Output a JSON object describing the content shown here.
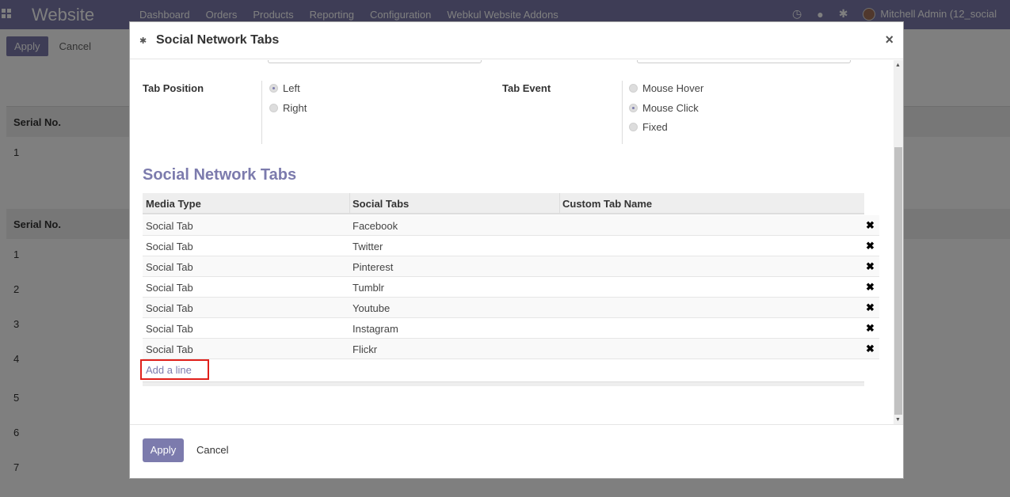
{
  "navbar": {
    "brand": "Website",
    "menu": [
      "Dashboard",
      "Orders",
      "Products",
      "Reporting",
      "Configuration",
      "Webkul Website Addons"
    ],
    "icons": [
      "clock-icon",
      "chat-icon",
      "bug-icon"
    ],
    "user": "Mitchell Admin (12_social"
  },
  "background": {
    "apply_label": "Apply",
    "cancel_label": "Cancel",
    "serial_header_1": "Serial No.",
    "serial_header_2": "Serial No.",
    "serial_values_1": [
      "1"
    ],
    "serial_values_2": [
      "1",
      "2",
      "3",
      "4",
      "5",
      "6",
      "7"
    ]
  },
  "modal": {
    "title": "Social Network Tabs",
    "close": "×",
    "tab_position": {
      "label": "Tab Position",
      "options": [
        {
          "label": "Left",
          "checked": true
        },
        {
          "label": "Right",
          "checked": false
        }
      ]
    },
    "tab_event": {
      "label": "Tab Event",
      "options": [
        {
          "label": "Mouse Hover",
          "checked": false
        },
        {
          "label": "Mouse Click",
          "checked": true
        },
        {
          "label": "Fixed",
          "checked": false
        }
      ]
    },
    "section_title": "Social Network Tabs",
    "table": {
      "columns": [
        "Media Type",
        "Social Tabs",
        "Custom Tab Name"
      ],
      "rows": [
        {
          "media_type": "Social Tab",
          "social_tab": "Facebook",
          "custom_name": ""
        },
        {
          "media_type": "Social Tab",
          "social_tab": "Twitter",
          "custom_name": ""
        },
        {
          "media_type": "Social Tab",
          "social_tab": "Pinterest",
          "custom_name": ""
        },
        {
          "media_type": "Social Tab",
          "social_tab": "Tumblr",
          "custom_name": ""
        },
        {
          "media_type": "Social Tab",
          "social_tab": "Youtube",
          "custom_name": ""
        },
        {
          "media_type": "Social Tab",
          "social_tab": "Instagram",
          "custom_name": ""
        },
        {
          "media_type": "Social Tab",
          "social_tab": "Flickr",
          "custom_name": ""
        }
      ],
      "delete_glyph": "✖",
      "add_line": "Add a line"
    },
    "footer": {
      "apply_label": "Apply",
      "cancel_label": "Cancel"
    }
  },
  "colors": {
    "brand": "#7c7bad",
    "highlight": "#e0201b"
  }
}
